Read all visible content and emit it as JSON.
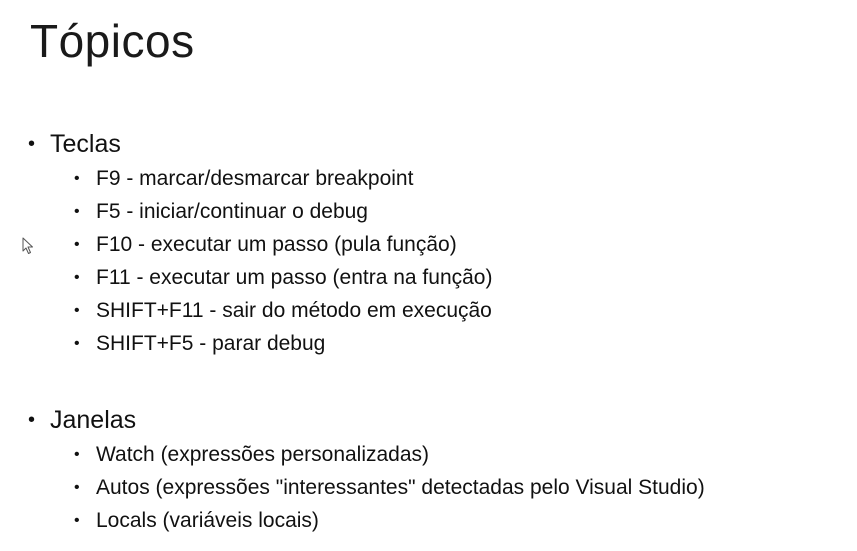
{
  "slide": {
    "title": "Tópicos"
  },
  "sections": [
    {
      "heading": "Teclas",
      "items": [
        "F9 - marcar/desmarcar breakpoint",
        "F5 - iniciar/continuar o debug",
        "F10 - executar um passo (pula função)",
        "F11 - executar um passo (entra na função)",
        "SHIFT+F11 - sair do método em execução",
        "SHIFT+F5 - parar debug"
      ]
    },
    {
      "heading": "Janelas",
      "items": [
        "Watch (expressões personalizadas)",
        "Autos (expressões \"interessantes\" detectadas pelo Visual Studio)",
        "Locals (variáveis locais)"
      ]
    }
  ],
  "bullet_glyph": "•",
  "icons": {
    "cursor": "mouse-pointer-icon"
  }
}
